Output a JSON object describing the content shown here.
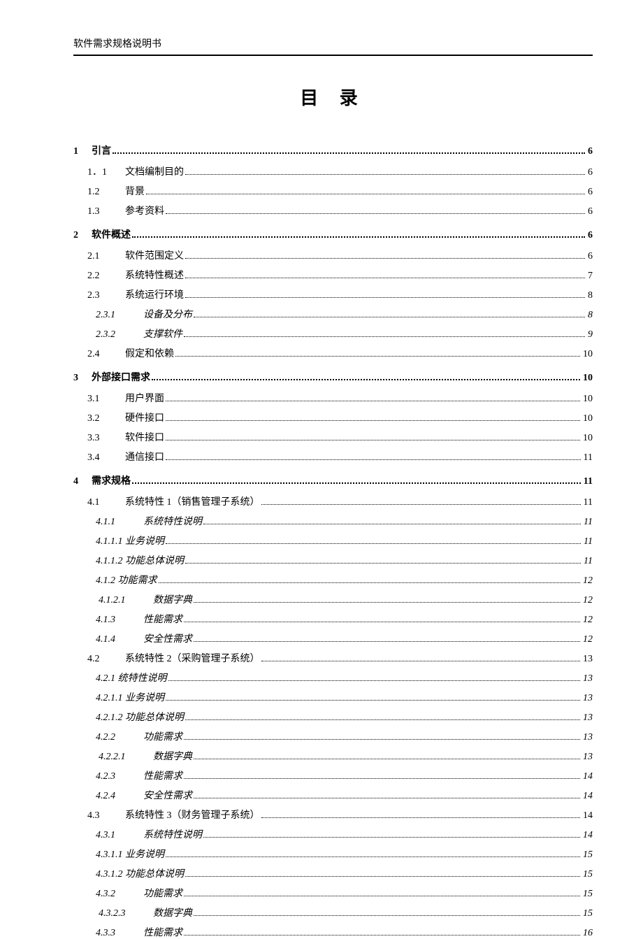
{
  "header": "软件需求规格说明书",
  "title": "目  录",
  "toc": [
    {
      "level": 1,
      "num": "1",
      "text": "引言",
      "page": "6"
    },
    {
      "level": 2,
      "num": "1．1",
      "text": "文档编制目的",
      "page": "6"
    },
    {
      "level": 2,
      "num": "1.2",
      "text": "背景",
      "page": "6"
    },
    {
      "level": 2,
      "num": "1.3",
      "text": "参考资料",
      "page": "6"
    },
    {
      "level": 1,
      "num": "2",
      "text": "软件概述",
      "page": "6"
    },
    {
      "level": 2,
      "num": "2.1",
      "text": "软件范围定义",
      "page": "6"
    },
    {
      "level": 2,
      "num": "2.2",
      "text": "系统特性概述",
      "page": "7"
    },
    {
      "level": 2,
      "num": "2.3",
      "text": "系统运行环境",
      "page": "8"
    },
    {
      "level": 3,
      "num": "2.3.1",
      "text": "设备及分布",
      "page": "8"
    },
    {
      "level": 3,
      "num": "2.3.2",
      "text": "支撑软件",
      "page": "9"
    },
    {
      "level": 2,
      "num": "2.4",
      "text": "假定和依赖",
      "page": "10"
    },
    {
      "level": 1,
      "num": "3",
      "text": "外部接口需求",
      "page": "10"
    },
    {
      "level": 2,
      "num": "3.1",
      "text": "用户界面",
      "page": "10"
    },
    {
      "level": 2,
      "num": "3.2",
      "text": "硬件接口",
      "page": "10"
    },
    {
      "level": 2,
      "num": "3.3",
      "text": "软件接口",
      "page": "10"
    },
    {
      "level": 2,
      "num": "3.4",
      "text": "通信接口",
      "page": "11"
    },
    {
      "level": 1,
      "num": "4",
      "text": "需求规格",
      "page": "11"
    },
    {
      "level": 2,
      "num": "4.1",
      "text": "系统特性 1（销售管理子系统）",
      "page": "11"
    },
    {
      "level": 3,
      "num": "4.1.1",
      "text": "系统特性说明",
      "page": "11"
    },
    {
      "level": 4,
      "num": "",
      "text": "4.1.1.1 业务说明",
      "page": "11"
    },
    {
      "level": 4,
      "num": "",
      "text": "4.1.1.2 功能总体说明",
      "page": "11"
    },
    {
      "level": 4,
      "num": "",
      "text": "4.1.2 功能需求",
      "page": "12"
    },
    {
      "level": 5,
      "num": "4.1.2.1",
      "text": "数据字典",
      "page": "12"
    },
    {
      "level": 3,
      "num": "4.1.3",
      "text": "性能需求",
      "page": "12"
    },
    {
      "level": 3,
      "num": "4.1.4",
      "text": "安全性需求",
      "page": "12"
    },
    {
      "level": 2,
      "num": "4.2",
      "text": "系统特性 2（采购管理子系统）",
      "page": "13"
    },
    {
      "level": 4,
      "num": "",
      "text": "4.2.1 统特性说明",
      "page": "13"
    },
    {
      "level": 4,
      "num": "",
      "text": "4.2.1.1 业务说明",
      "page": "13"
    },
    {
      "level": 4,
      "num": "",
      "text": "4.2.1.2 功能总体说明",
      "page": "13"
    },
    {
      "level": 3,
      "num": "4.2.2",
      "text": "功能需求",
      "page": "13"
    },
    {
      "level": 5,
      "num": "4.2.2.1",
      "text": "数据字典",
      "page": "13"
    },
    {
      "level": 3,
      "num": "4.2.3",
      "text": "性能需求",
      "page": "14"
    },
    {
      "level": 3,
      "num": "4.2.4",
      "text": "安全性需求",
      "page": "14"
    },
    {
      "level": 2,
      "num": "4.3",
      "text": "系统特性 3（财务管理子系统）",
      "page": "14"
    },
    {
      "level": 3,
      "num": "4.3.1",
      "text": "系统特性说明",
      "page": "14"
    },
    {
      "level": 4,
      "num": "",
      "text": "4.3.1.1 业务说明",
      "page": "15"
    },
    {
      "level": 4,
      "num": "",
      "text": "4.3.1.2 功能总体说明",
      "page": "15"
    },
    {
      "level": 3,
      "num": "4.3.2",
      "text": "功能需求",
      "page": "15"
    },
    {
      "level": 5,
      "num": "4.3.2.3",
      "text": "数据字典",
      "page": "15"
    },
    {
      "level": 3,
      "num": "4.3.3",
      "text": "性能需求",
      "page": "16"
    }
  ]
}
